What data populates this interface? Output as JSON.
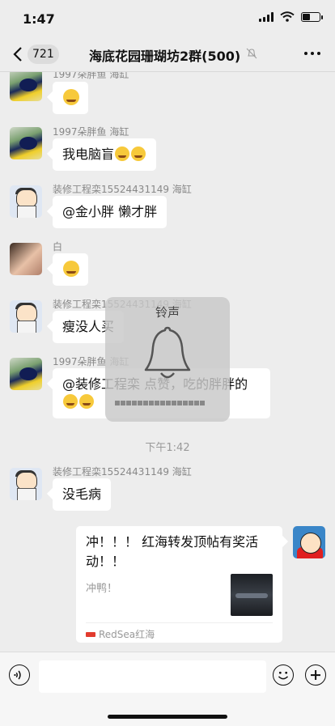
{
  "status_bar": {
    "time": "1:47"
  },
  "nav": {
    "back_count": "721",
    "title": "海底花园珊瑚坊2群(500)"
  },
  "messages": [
    {
      "sender": "1997朵胖鱼 海缸",
      "text": ""
    },
    {
      "sender": "1997朵胖鱼 海缸",
      "text": "我电脑盲"
    },
    {
      "sender": "装修工程栾15524431149 海缸",
      "text": "@金小胖 懒才胖"
    },
    {
      "sender": "白",
      "text": ""
    },
    {
      "sender": "装修工程栾15524431149 海缸",
      "text": "瘦没人买"
    },
    {
      "sender": "1997朵胖鱼 海缸",
      "text": "@装修工程栾 点赞，吃的胖胖的"
    },
    {
      "sender": "装修工程栾15524431149 海缸",
      "text": "没毛病"
    }
  ],
  "time_divider": "下午1:42",
  "link_card": {
    "title": "冲！！！ 红海转发顶帖有奖活动！！",
    "description": "冲鸭！",
    "source": "RedSea红海"
  },
  "overlay": {
    "title": "铃声",
    "level_bars": 16
  },
  "input": {
    "placeholder": ""
  }
}
